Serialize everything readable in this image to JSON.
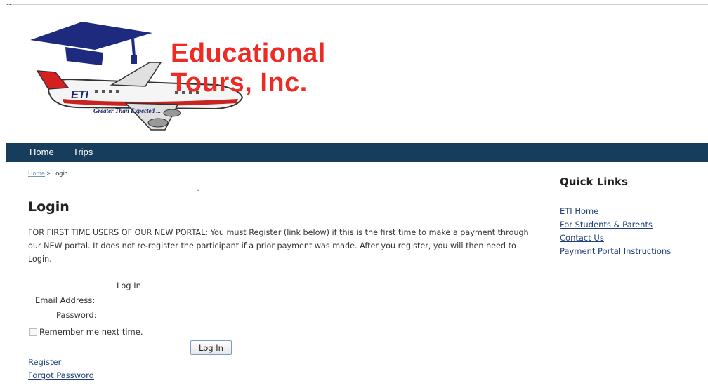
{
  "corner_glyph": "g",
  "logo": {
    "brand_line1": "Educational",
    "brand_line2": "Tours, Inc.",
    "badge": "ETI",
    "tagline": "Greater Than Expected ..."
  },
  "nav": {
    "items": [
      {
        "label": "Home"
      },
      {
        "label": "Trips"
      }
    ]
  },
  "breadcrumb": {
    "home": "Home",
    "separator": " > ",
    "current": "Login"
  },
  "main": {
    "title": "Login",
    "intro": "FOR FIRST TIME USERS OF OUR NEW PORTAL: You must Register (link below) if this is the first time to make a payment through our NEW portal. It does not re-register the participant if a prior payment was made. After you register, you will then need to Login."
  },
  "login_form": {
    "title": "Log In",
    "email_label": "Email Address:",
    "email_value": "",
    "password_label": "Password:",
    "password_value": "",
    "remember_label": "Remember me next time.",
    "remember_checked": false,
    "submit_label": "Log In"
  },
  "links": {
    "register": "Register",
    "forgot_password": "Forgot Password"
  },
  "quick_links": {
    "title": "Quick Links",
    "items": [
      {
        "label": "ETI Home"
      },
      {
        "label": "For Students & Parents"
      },
      {
        "label": "Contact Us"
      },
      {
        "label": "Payment Portal Instructions"
      }
    ]
  },
  "colors": {
    "nav_background": "#173d5c",
    "brand_red": "#ee2a24",
    "brand_navy": "#1c2a6e",
    "link": "#1f3f7a"
  }
}
